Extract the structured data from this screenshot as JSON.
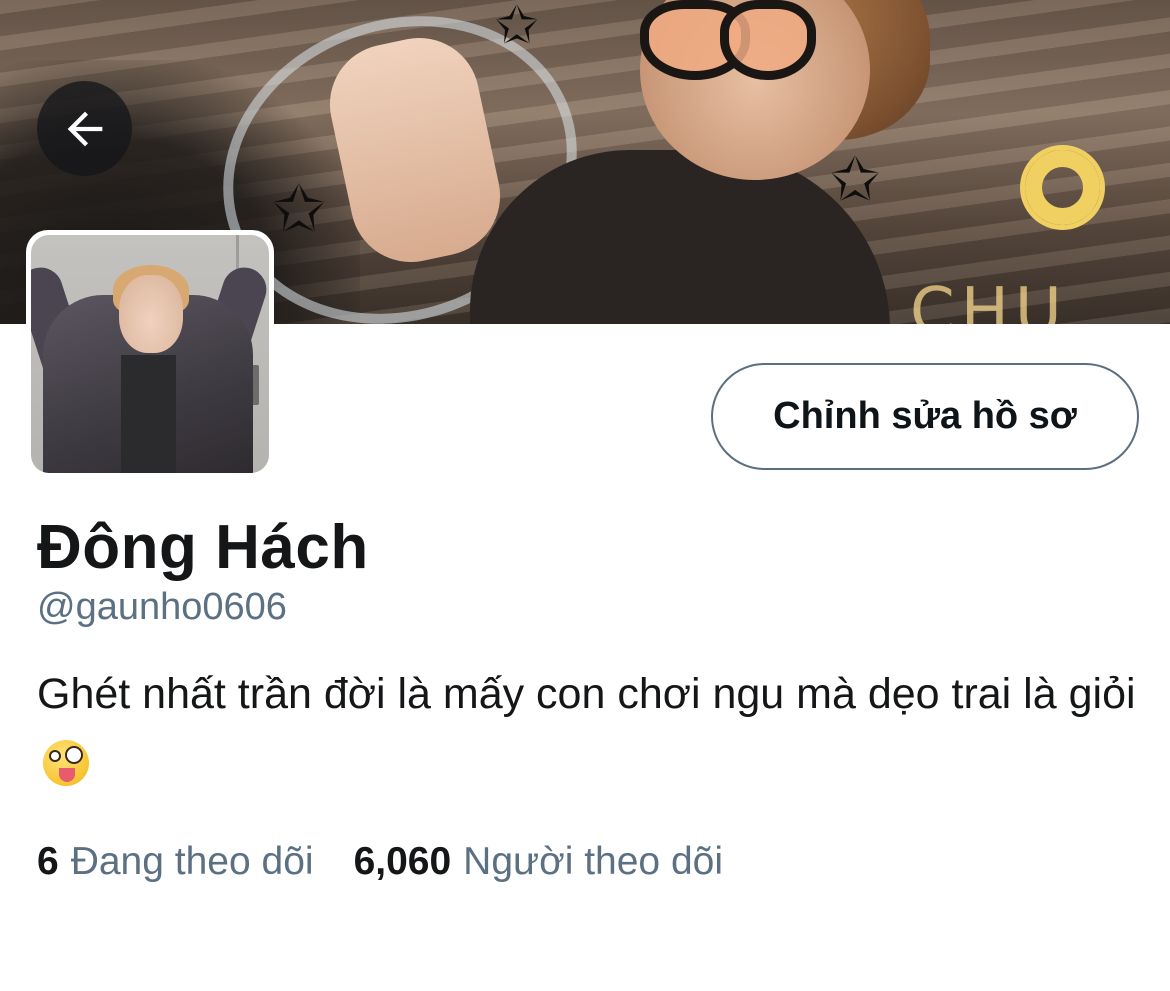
{
  "header": {
    "back_icon": "arrow-left-icon"
  },
  "profile": {
    "edit_button_label": "Chỉnh sửa hồ sơ",
    "display_name": "Đông Hách",
    "handle": "@gaunho0606",
    "bio_text": "Ghét nhất trần đời là mấy con chơi ngu mà dẹo trai là giỏi",
    "bio_emoji": "zany-face-emoji"
  },
  "stats": {
    "following_count": "6",
    "following_label": "Đang theo dõi",
    "followers_count": "6,060",
    "followers_label": "Người theo dõi"
  },
  "colors": {
    "text_primary": "#141618",
    "text_secondary": "#5b7083",
    "button_border": "#5b6f80"
  }
}
